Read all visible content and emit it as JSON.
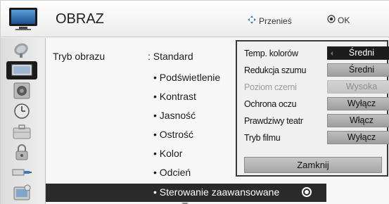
{
  "header": {
    "title": "OBRAZ",
    "hint_move": "Przenieś",
    "hint_ok": "OK"
  },
  "sidebar": {
    "items": [
      {
        "icon": "satellite-dish-icon"
      },
      {
        "icon": "tv-picture-icon",
        "active": true
      },
      {
        "icon": "speaker-icon"
      },
      {
        "icon": "clock-icon"
      },
      {
        "icon": "suitcase-icon"
      },
      {
        "icon": "lock-icon"
      },
      {
        "icon": "input-plug-icon"
      },
      {
        "icon": "support-icon"
      }
    ]
  },
  "main": {
    "mode_label": "Tryb obrazu",
    "mode_value": ": Standard",
    "items": [
      "• Podświetlenie",
      "• Kontrast",
      "• Jasność",
      "• Ostrość",
      "• Kolor",
      "• Odcień"
    ],
    "selected_item": "• Sterowanie zaawansowane"
  },
  "popup": {
    "rows": [
      {
        "label": "Temp. kolorów",
        "value": "Średni"
      },
      {
        "label": "Redukcja szumu",
        "value": "Średni"
      },
      {
        "label": "Poziom czerni",
        "value": "Wysoka"
      },
      {
        "label": "Ochrona oczu",
        "value": "Wyłącz"
      },
      {
        "label": "Prawdziwy teatr",
        "value": "Włącz"
      },
      {
        "label": "Tryb filmu",
        "value": "Wyłącz"
      }
    ],
    "close_label": "Zamknij"
  },
  "colors": {
    "selected_bg": "#2a2a2a",
    "value_box": "#a8a8a8",
    "active_value": "#1c1c1c"
  }
}
